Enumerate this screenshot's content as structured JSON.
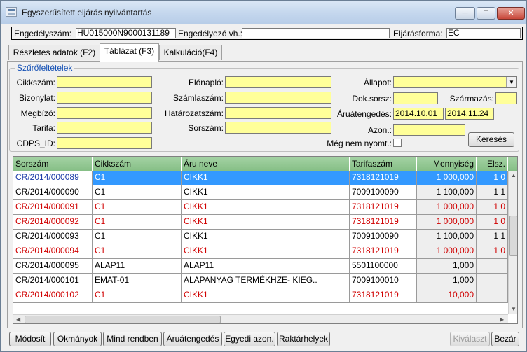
{
  "window": {
    "title": "Egyszerűsített eljárás nyilvántartás"
  },
  "header": {
    "engedely_label": "Engedélyszám:",
    "engedely_value": "HU015000N9000131189",
    "engedelyezo_label": "Engedélyező vh.:",
    "engedelyezo_value": "",
    "eljarasforma_label": "Eljárásforma:",
    "eljarasforma_value": "EC"
  },
  "tabs": [
    {
      "label": "Részletes adatok (F2)"
    },
    {
      "label": "Táblázat (F3)"
    },
    {
      "label": "Kalkuláció(F4)"
    }
  ],
  "filters": {
    "group_title": "Szűrőfeltételek",
    "cikkszam": "Cikkszám:",
    "bizonylat": "Bizonylat:",
    "megbizo": "Megbízó:",
    "tarifa": "Tarifa:",
    "cdps": "CDPS_ID:",
    "elonaplo": "Előnapló:",
    "szamlaszam": "Számlaszám:",
    "hatarozatszam": "Határozatszám:",
    "sorszam": "Sorszám:",
    "allapot": "Állapot:",
    "doksorsz": "Dok.sorsz:",
    "szarmazas": "Származás:",
    "aruategedes": "Áruátengedés:",
    "date_from": "2014.10.01",
    "date_to": "2014.11.24",
    "azon": "Azon.:",
    "meg_nem_nyomt": "Még nem nyomt.:",
    "search_button": "Keresés"
  },
  "grid": {
    "columns": [
      "Sorszám",
      "Cikkszám",
      "Áru neve",
      "Tarifaszám",
      "Mennyiség",
      "Elsz."
    ],
    "rows": [
      {
        "sorszam": "CR/2014/000089",
        "cikk": "C1",
        "nev": "CIKK1",
        "tarifa": "7318121019",
        "menny": "1 000,000",
        "elsz": "1 0",
        "style": "selected"
      },
      {
        "sorszam": "CR/2014/000090",
        "cikk": "C1",
        "nev": "CIKK1",
        "tarifa": "7009100090",
        "menny": "1 100,000",
        "elsz": "1 1",
        "style": "normal"
      },
      {
        "sorszam": "CR/2014/000091",
        "cikk": "C1",
        "nev": "CIKK1",
        "tarifa": "7318121019",
        "menny": "1 000,000",
        "elsz": "1 0",
        "style": "red"
      },
      {
        "sorszam": "CR/2014/000092",
        "cikk": "C1",
        "nev": "CIKK1",
        "tarifa": "7318121019",
        "menny": "1 000,000",
        "elsz": "1 0",
        "style": "red"
      },
      {
        "sorszam": "CR/2014/000093",
        "cikk": "C1",
        "nev": "CIKK1",
        "tarifa": "7009100090",
        "menny": "1 100,000",
        "elsz": "1 1",
        "style": "normal"
      },
      {
        "sorszam": "CR/2014/000094",
        "cikk": "C1",
        "nev": "CIKK1",
        "tarifa": "7318121019",
        "menny": "1 000,000",
        "elsz": "1 0",
        "style": "red"
      },
      {
        "sorszam": "CR/2014/000095",
        "cikk": "ALAP11",
        "nev": "ALAP11",
        "tarifa": "5501100000",
        "menny": "1,000",
        "elsz": "",
        "style": "normal"
      },
      {
        "sorszam": "CR/2014/000101",
        "cikk": "EMAT-01",
        "nev": "ALAPANYAG TERMÉKHZE- KIEG..",
        "tarifa": "7009100010",
        "menny": "1,000",
        "elsz": "",
        "style": "normal"
      },
      {
        "sorszam": "CR/2014/000102",
        "cikk": "C1",
        "nev": "CIKK1",
        "tarifa": "7318121019",
        "menny": "10,000",
        "elsz": "",
        "style": "red"
      }
    ]
  },
  "buttons": {
    "modosit": "Módosít",
    "okmanyok": "Okmányok",
    "mind_rendben": "Mind rendben",
    "aruategedes": "Áruátengedés",
    "egyedi_azon": "Egyedi azon.",
    "raktarhelyek": "Raktárhelyek",
    "kivalaszt": "Kiválaszt",
    "bezar": "Bezár"
  },
  "colors": {
    "selection": "#3399ff",
    "filter_field": "#ffff99",
    "grid_header": "#94c894",
    "error_row": "#d00000"
  }
}
